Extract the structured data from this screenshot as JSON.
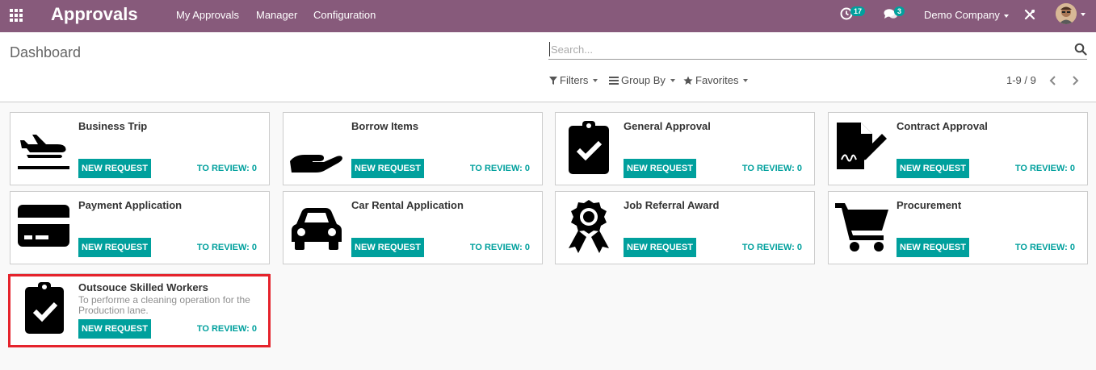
{
  "navbar": {
    "app_title": "Approvals",
    "menu": [
      "My Approvals",
      "Manager",
      "Configuration"
    ],
    "activity_count": "17",
    "messages_count": "3",
    "company": "Demo Company",
    "accent_color": "#875a7b",
    "icons": {
      "apps": "apps-grid-icon",
      "activity": "clock-icon",
      "messages": "chat-icon",
      "debug": "tools-icon"
    }
  },
  "control_panel": {
    "breadcrumb": "Dashboard",
    "search_placeholder": "Search...",
    "filters_label": "Filters",
    "group_by_label": "Group By",
    "favorites_label": "Favorites",
    "pager_value": "1-9 / 9"
  },
  "cards": [
    {
      "title": "Business Trip",
      "description": "",
      "button": "NEW REQUEST",
      "review": "TO REVIEW: 0",
      "icon": "airplane-icon"
    },
    {
      "title": "Borrow Items",
      "description": "",
      "button": "NEW REQUEST",
      "review": "TO REVIEW: 0",
      "icon": "hand-icon"
    },
    {
      "title": "General Approval",
      "description": "",
      "button": "NEW REQUEST",
      "review": "TO REVIEW: 0",
      "icon": "clipboard-check-icon"
    },
    {
      "title": "Contract Approval",
      "description": "",
      "button": "NEW REQUEST",
      "review": "TO REVIEW: 0",
      "icon": "contract-sign-icon"
    },
    {
      "title": "Payment Application",
      "description": "",
      "button": "NEW REQUEST",
      "review": "TO REVIEW: 0",
      "icon": "credit-card-icon"
    },
    {
      "title": "Car Rental Application",
      "description": "",
      "button": "NEW REQUEST",
      "review": "TO REVIEW: 0",
      "icon": "car-icon"
    },
    {
      "title": "Job Referral Award",
      "description": "",
      "button": "NEW REQUEST",
      "review": "TO REVIEW: 0",
      "icon": "award-ribbon-icon"
    },
    {
      "title": "Procurement",
      "description": "",
      "button": "NEW REQUEST",
      "review": "TO REVIEW: 0",
      "icon": "shopping-cart-icon"
    },
    {
      "title": "Outsouce Skilled Workers",
      "description": "To performe a cleaning operation for the Production lane.",
      "button": "NEW REQUEST",
      "review": "TO REVIEW: 0",
      "icon": "clipboard-check-icon"
    }
  ],
  "colors": {
    "primary": "#00a09d",
    "highlight_border": "#e5232c"
  }
}
